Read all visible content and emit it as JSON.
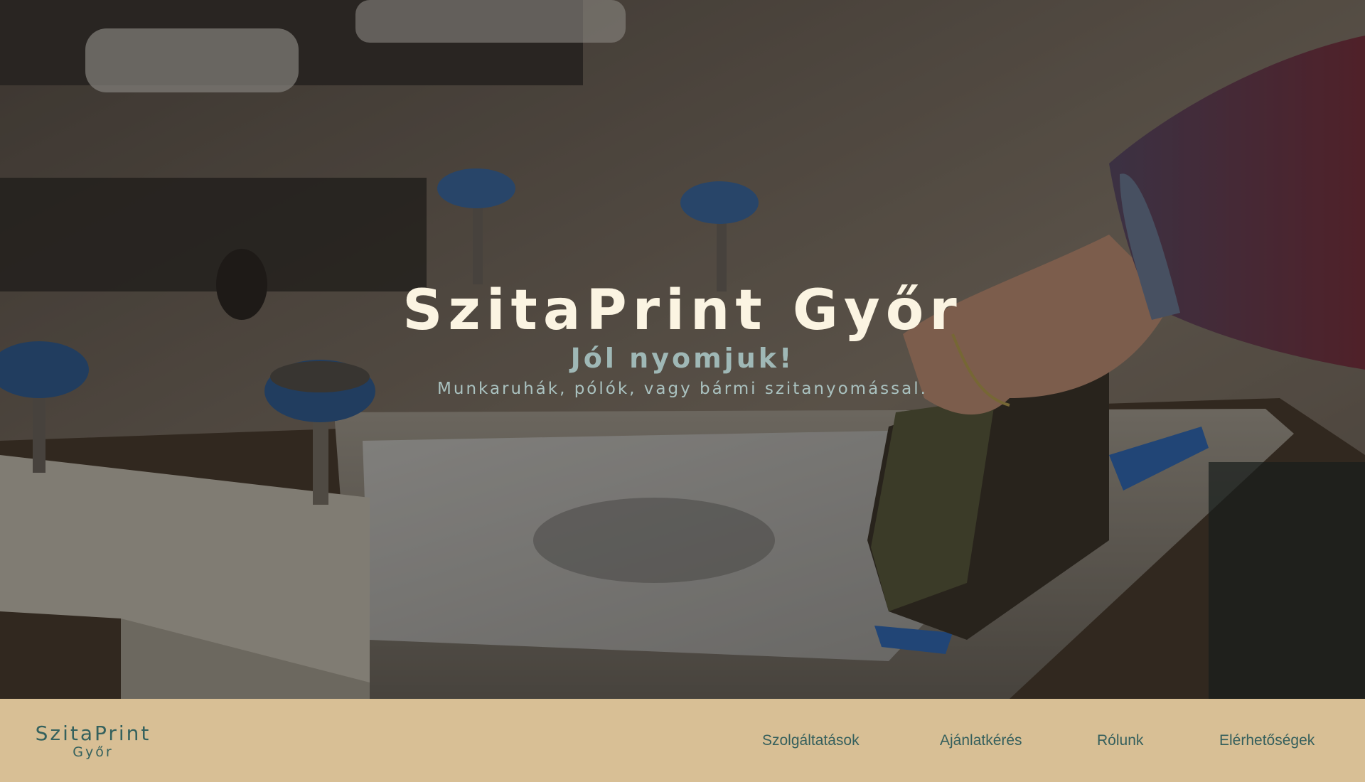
{
  "hero": {
    "title": "SzitaPrint Győr",
    "slogan": "Jól nyomjuk!",
    "subtitle": "Munkaruhák, pólók, vagy bármi szitanyomással."
  },
  "nav": {
    "logo_main": "SzitaPrint",
    "logo_sub": "Győr",
    "links": [
      {
        "label": "Szolgáltatások"
      },
      {
        "label": "Ajánlatkérés"
      },
      {
        "label": "Rólunk"
      },
      {
        "label": "Elérhetőségek"
      }
    ]
  },
  "colors": {
    "nav_background": "#d8bf95",
    "nav_text": "#355f5c",
    "title_text": "#fbf4e2",
    "slogan_text": "#9fb8b6"
  }
}
